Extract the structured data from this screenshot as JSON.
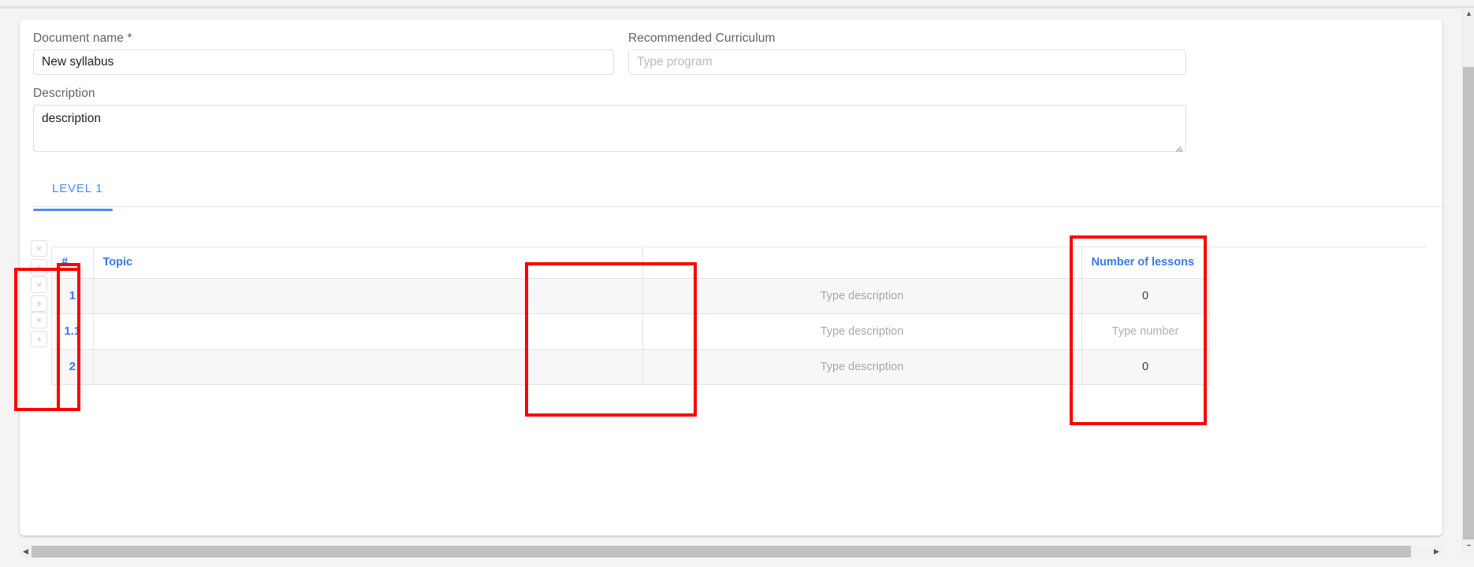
{
  "form": {
    "document_name": {
      "label": "Document name *",
      "value": "New syllabus",
      "placeholder": ""
    },
    "recommended_curriculum": {
      "label": "Recommended Curriculum",
      "value": "",
      "placeholder": "Type program"
    },
    "description": {
      "label": "Description",
      "value": "description",
      "placeholder": ""
    }
  },
  "tabs": [
    {
      "label": "LEVEL 1",
      "active": true
    }
  ],
  "rail": {
    "buttons": [
      {
        "icon": "close-icon",
        "glyph": "×"
      },
      {
        "icon": "plus-icon",
        "glyph": "+"
      },
      {
        "icon": "close-icon",
        "glyph": "×"
      },
      {
        "icon": "plus-icon",
        "glyph": "+"
      },
      {
        "icon": "close-icon",
        "glyph": "×"
      },
      {
        "icon": "plus-icon",
        "glyph": "+"
      }
    ]
  },
  "table": {
    "headers": {
      "number": "#",
      "topic": "Topic",
      "description": "",
      "lessons": "Number of lessons"
    },
    "rows": [
      {
        "number": "1",
        "topic": "",
        "description": "Type description",
        "lessons": "0",
        "lessons_is_placeholder": false,
        "shaded": true
      },
      {
        "number": "1.1",
        "topic": "",
        "description": "Type description",
        "lessons": "Type number",
        "lessons_is_placeholder": true,
        "shaded": false
      },
      {
        "number": "2",
        "topic": "",
        "description": "Type description",
        "lessons": "0",
        "lessons_is_placeholder": false,
        "shaded": true
      }
    ]
  },
  "annotations": [
    {
      "name": "row-action-buttons-highlight"
    },
    {
      "name": "number-column-highlight"
    },
    {
      "name": "description-column-highlight"
    },
    {
      "name": "number-of-lessons-column-highlight"
    }
  ],
  "scrollbars": {
    "vertical": {
      "up_arrow": "▲",
      "down_arrow": "▼"
    },
    "horizontal": {
      "left_arrow": "◀",
      "right_arrow": "▶"
    }
  },
  "colors": {
    "accent_blue": "#3b78e7",
    "tab_blue": "#4a8bf0",
    "annotation_red": "#fe0000",
    "row_shade": "#f7f7f7",
    "placeholder_gray": "#a8a8a8"
  }
}
